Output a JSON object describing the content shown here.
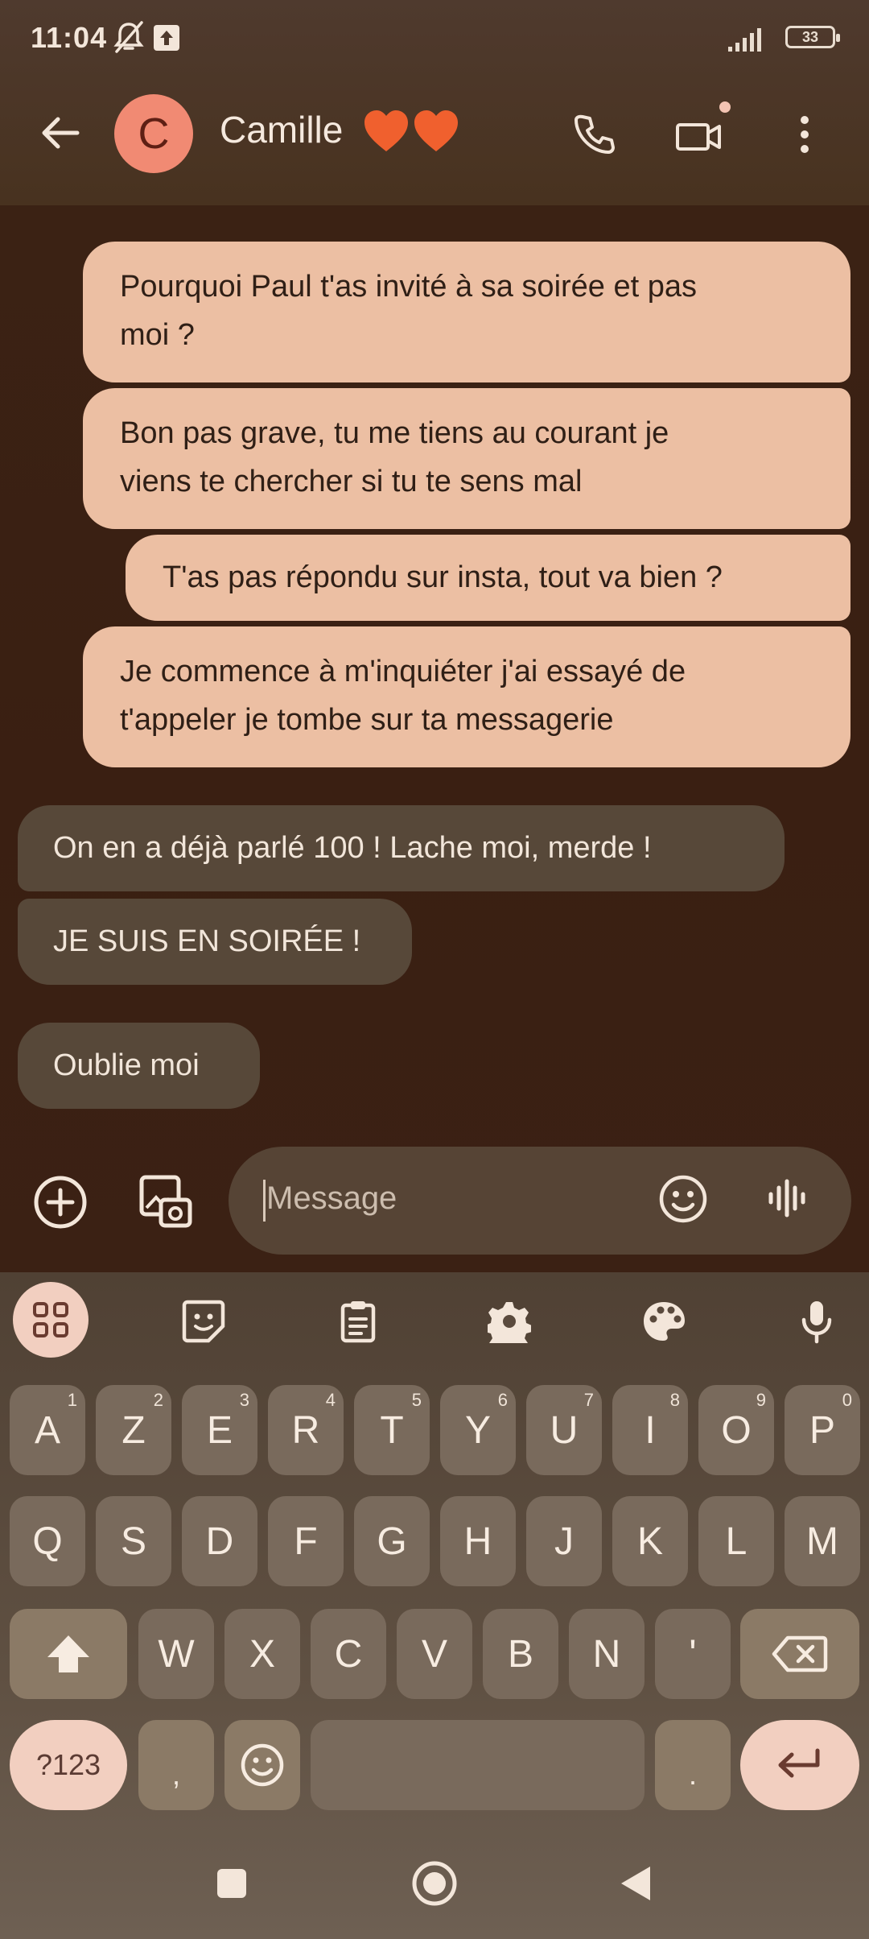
{
  "status_bar": {
    "time": "11:04",
    "battery": "33"
  },
  "header": {
    "avatar_letter": "C",
    "contact_name": "Camille",
    "hearts": "❤️❤️"
  },
  "messages": [
    {
      "direction": "outgoing",
      "lines": [
        "Pourquoi Paul t'as invité à sa soirée et pas",
        "moi ?"
      ]
    },
    {
      "direction": "outgoing",
      "lines": [
        "Bon pas grave, tu me tiens au courant je",
        "viens te chercher si tu te sens mal"
      ]
    },
    {
      "direction": "outgoing",
      "lines": [
        "T'as pas répondu sur insta, tout va bien ?"
      ]
    },
    {
      "direction": "outgoing",
      "lines": [
        "Je commence à m'inquiéter j'ai essayé de",
        "t'appeler je tombe sur ta messagerie"
      ]
    },
    {
      "direction": "incoming",
      "lines": [
        "On en a déjà parlé 100 ! Lache moi, merde !"
      ]
    },
    {
      "direction": "incoming",
      "lines": [
        "JE SUIS EN SOIRÉE !"
      ]
    },
    {
      "direction": "incoming",
      "lines": [
        "Oublie moi"
      ]
    }
  ],
  "compose": {
    "placeholder": "Message"
  },
  "keyboard": {
    "row1": [
      {
        "key": "A",
        "num": "1"
      },
      {
        "key": "Z",
        "num": "2"
      },
      {
        "key": "E",
        "num": "3"
      },
      {
        "key": "R",
        "num": "4"
      },
      {
        "key": "T",
        "num": "5"
      },
      {
        "key": "Y",
        "num": "6"
      },
      {
        "key": "U",
        "num": "7"
      },
      {
        "key": "I",
        "num": "8"
      },
      {
        "key": "O",
        "num": "9"
      },
      {
        "key": "P",
        "num": "0"
      }
    ],
    "row2": [
      "Q",
      "S",
      "D",
      "F",
      "G",
      "H",
      "J",
      "K",
      "L",
      "M"
    ],
    "row3": [
      "W",
      "X",
      "C",
      "V",
      "B",
      "N",
      "'"
    ],
    "symbols_label": "?123",
    "comma": ",",
    "period": "."
  },
  "colors": {
    "outgoing_bubble": "#ecbfa3",
    "incoming_bubble": "#574839",
    "avatar": "#f18a73",
    "accent_key": "#f2cfc0"
  }
}
